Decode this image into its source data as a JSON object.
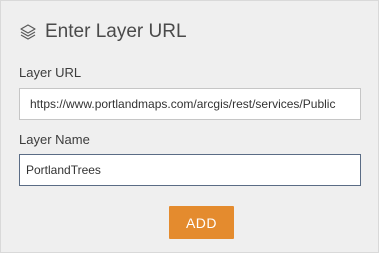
{
  "panel": {
    "title": "Enter Layer URL",
    "icon": "layers-icon"
  },
  "layer_url": {
    "label": "Layer URL",
    "value": "https://www.portlandmaps.com/arcgis/rest/services/Public"
  },
  "layer_name": {
    "label": "Layer Name",
    "value": "PortlandTrees"
  },
  "add_button": {
    "label": "ADD",
    "color": "#e48b2e"
  }
}
